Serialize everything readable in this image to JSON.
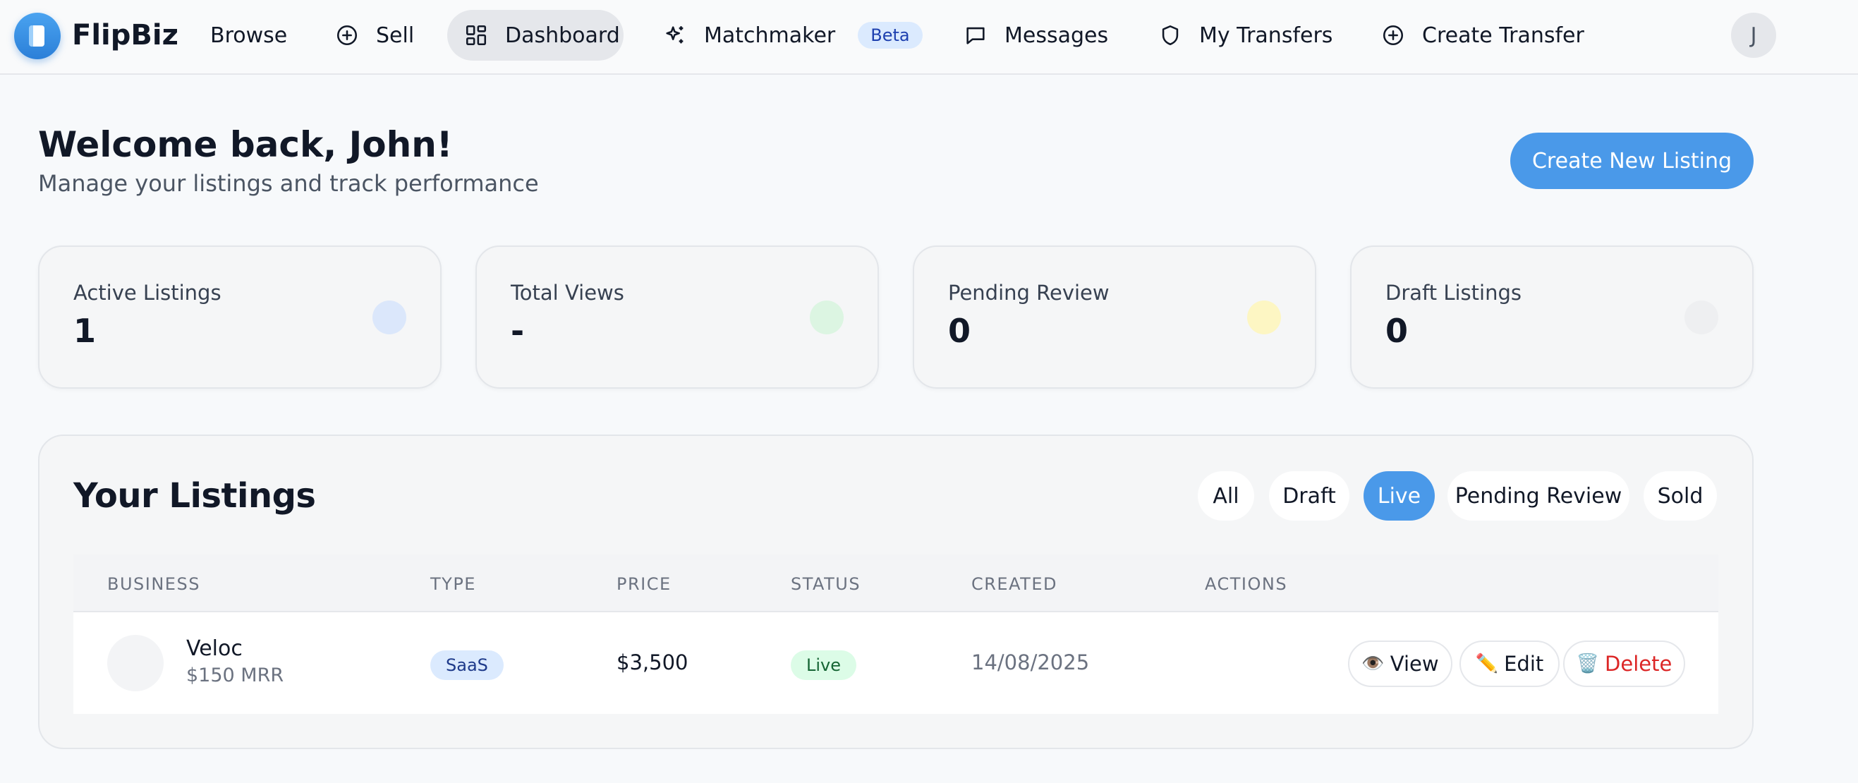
{
  "nav": {
    "brand": "FlipBiz",
    "items": [
      {
        "label": "Browse"
      },
      {
        "label": "Sell"
      },
      {
        "label": "Dashboard"
      },
      {
        "label": "Matchmaker",
        "badge": "Beta"
      },
      {
        "label": "Messages"
      },
      {
        "label": "My Transfers"
      },
      {
        "label": "Create Transfer"
      }
    ],
    "active": "Dashboard",
    "avatar_initial": "J"
  },
  "header": {
    "title": "Welcome back, John!",
    "subtitle": "Manage your listings and track performance",
    "cta_label": "Create New Listing"
  },
  "stats": [
    {
      "label": "Active Listings",
      "value": "1",
      "dot_color": "#dbe7fb"
    },
    {
      "label": "Total Views",
      "value": "-",
      "dot_color": "#dcf5e2"
    },
    {
      "label": "Pending Review",
      "value": "0",
      "dot_color": "#fdf6c3"
    },
    {
      "label": "Draft Listings",
      "value": "0",
      "dot_color": "#eeeff1"
    }
  ],
  "listings": {
    "title": "Your Listings",
    "filters": [
      "All",
      "Draft",
      "Live",
      "Pending Review",
      "Sold"
    ],
    "active_filter": "Live",
    "columns": [
      "BUSINESS",
      "TYPE",
      "PRICE",
      "STATUS",
      "CREATED",
      "ACTIONS"
    ],
    "rows": [
      {
        "name": "Veloc",
        "mrr": "$150 MRR",
        "type": "SaaS",
        "price": "$3,500",
        "status": "Live",
        "created": "14/08/2025",
        "actions": {
          "view": "View",
          "edit": "Edit",
          "delete": "Delete"
        }
      }
    ]
  },
  "icons": {
    "view": "👁️",
    "edit": "✏️",
    "delete": "🗑️"
  }
}
